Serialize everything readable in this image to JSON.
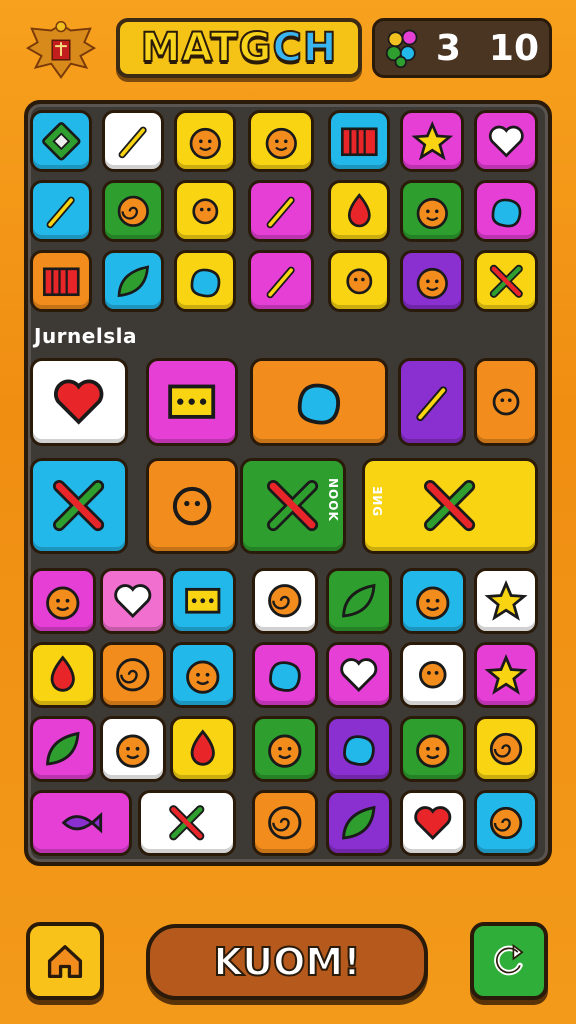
{
  "header": {
    "title_main": "MATG",
    "title_accent": "CH",
    "moves": "3",
    "score": "10"
  },
  "board": {
    "section_label": "Jurnelsla",
    "side_text_1": "NOOK",
    "side_text_2": "ƎИG",
    "side_text_3": "ƎИG"
  },
  "footer": {
    "main_button_label": "KUOM!"
  },
  "colors": {
    "cyan": "#23b8ea",
    "yellow": "#f8d412",
    "magenta": "#e63fd6",
    "green": "#2e9e2e",
    "orange": "#f28c1c",
    "purple": "#8a2fd0",
    "white": "#ffffff",
    "red": "#e8262a",
    "pink": "#f06fcf"
  },
  "icons": [
    "emblem-icon",
    "fruit-bunch-icon",
    "home-icon",
    "restart-icon"
  ]
}
